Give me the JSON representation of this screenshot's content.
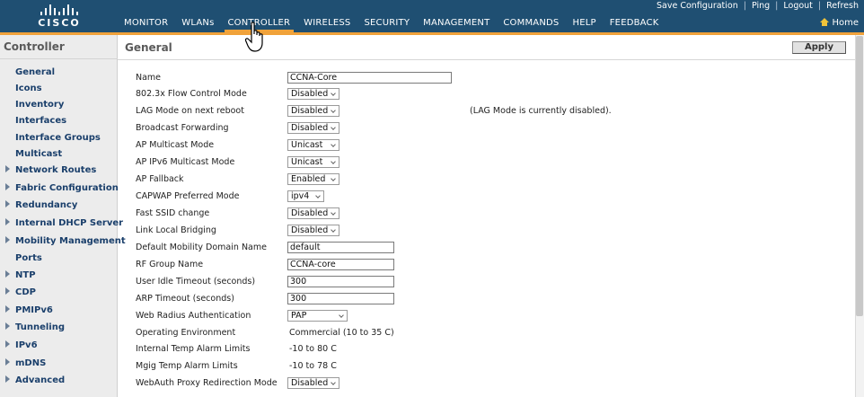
{
  "header": {
    "logo_text": "CISCO",
    "utility_links": [
      "Save Configuration",
      "Ping",
      "Logout",
      "Refresh"
    ],
    "home_label": "Home",
    "nav": [
      "MONITOR",
      "WLANs",
      "CONTROLLER",
      "WIRELESS",
      "SECURITY",
      "MANAGEMENT",
      "COMMANDS",
      "HELP",
      "FEEDBACK"
    ],
    "active_nav": "CONTROLLER",
    "accent_color": "#f0a23a",
    "header_color": "#1f4f72"
  },
  "sidebar": {
    "title": "Controller",
    "items": [
      {
        "label": "General",
        "expandable": false
      },
      {
        "label": "Icons",
        "expandable": false
      },
      {
        "label": "Inventory",
        "expandable": false
      },
      {
        "label": "Interfaces",
        "expandable": false
      },
      {
        "label": "Interface Groups",
        "expandable": false
      },
      {
        "label": "Multicast",
        "expandable": false
      },
      {
        "label": "Network Routes",
        "expandable": true
      },
      {
        "label": "Fabric Configuration",
        "expandable": true
      },
      {
        "label": "Redundancy",
        "expandable": true
      },
      {
        "label": "Internal DHCP Server",
        "expandable": true
      },
      {
        "label": "Mobility Management",
        "expandable": true
      },
      {
        "label": "Ports",
        "expandable": false
      },
      {
        "label": "NTP",
        "expandable": true
      },
      {
        "label": "CDP",
        "expandable": true
      },
      {
        "label": "PMIPv6",
        "expandable": true
      },
      {
        "label": "Tunneling",
        "expandable": true
      },
      {
        "label": "IPv6",
        "expandable": true
      },
      {
        "label": "mDNS",
        "expandable": true
      },
      {
        "label": "Advanced",
        "expandable": true
      }
    ]
  },
  "main": {
    "title": "General",
    "apply_label": "Apply",
    "rows": [
      {
        "label": "Name",
        "type": "text",
        "value": "CCNA-Core"
      },
      {
        "label": "802.3x Flow Control Mode",
        "type": "select",
        "value": "Disabled"
      },
      {
        "label": "LAG Mode on next reboot",
        "type": "select",
        "value": "Disabled",
        "note": "(LAG Mode is currently disabled)."
      },
      {
        "label": "Broadcast Forwarding",
        "type": "select",
        "value": "Disabled"
      },
      {
        "label": "AP Multicast Mode",
        "type": "select",
        "value": "Unicast"
      },
      {
        "label": "AP IPv6 Multicast Mode",
        "type": "select",
        "value": "Unicast"
      },
      {
        "label": "AP Fallback",
        "type": "select",
        "value": "Enabled"
      },
      {
        "label": "CAPWAP Preferred Mode",
        "type": "select",
        "value": "ipv4"
      },
      {
        "label": "Fast SSID change",
        "type": "select",
        "value": "Disabled"
      },
      {
        "label": "Link Local Bridging",
        "type": "select",
        "value": "Disabled"
      },
      {
        "label": "Default Mobility Domain Name",
        "type": "text",
        "value": "default"
      },
      {
        "label": "RF Group Name",
        "type": "text",
        "value": "CCNA-core"
      },
      {
        "label": "User Idle Timeout (seconds)",
        "type": "text",
        "value": "300"
      },
      {
        "label": "ARP Timeout (seconds)",
        "type": "text",
        "value": "300"
      },
      {
        "label": "Web Radius Authentication",
        "type": "select",
        "value": "PAP"
      },
      {
        "label": "Operating Environment",
        "type": "static",
        "value": "Commercial (10 to 35 C)"
      },
      {
        "label": "Internal Temp Alarm Limits",
        "type": "static",
        "value": "-10 to 80 C"
      },
      {
        "label": "Mgig Temp Alarm Limits",
        "type": "static",
        "value": "-10 to 78 C"
      },
      {
        "label": "WebAuth Proxy Redirection Mode",
        "type": "select",
        "value": "Disabled"
      }
    ]
  }
}
